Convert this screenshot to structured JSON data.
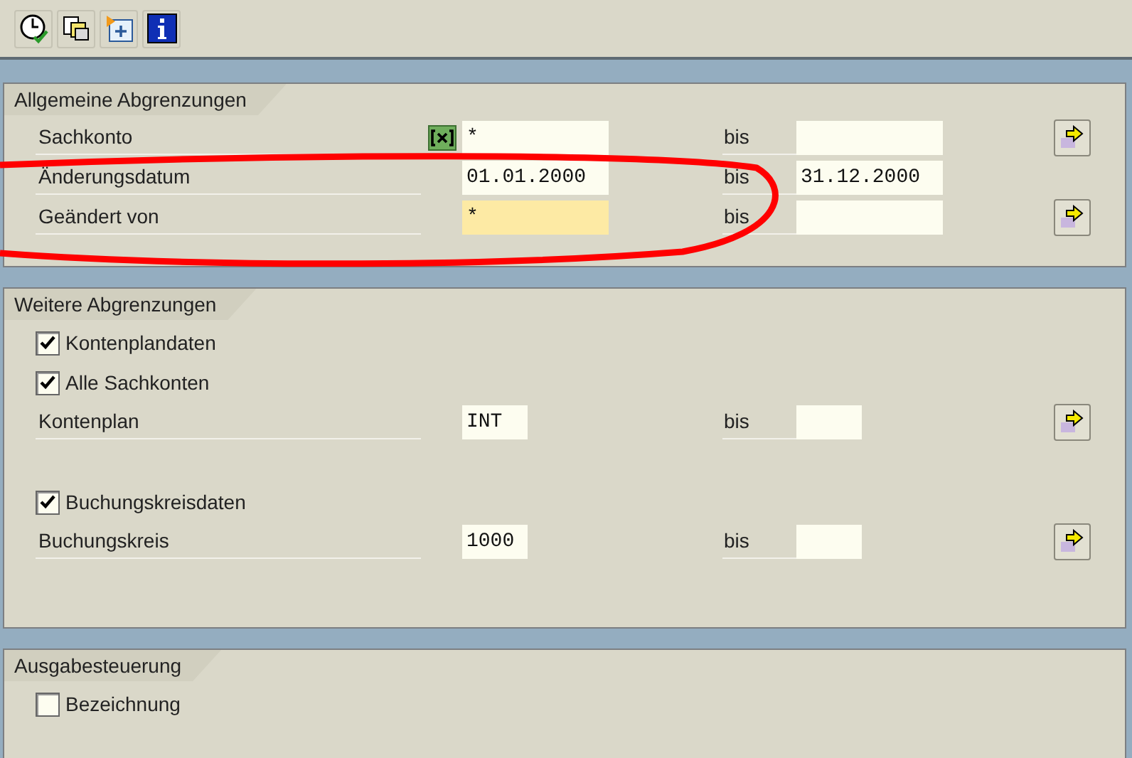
{
  "panels": [
    {
      "title": "Allgemeine Abgrenzungen",
      "groups": [
        [
          {
            "kind": "range",
            "label": "Sachkonto",
            "multi_select": true,
            "from": {
              "value": "*",
              "highlighted": false
            },
            "to_label": "bis",
            "more_button": true
          },
          {
            "kind": "range",
            "label": "Änderungsdatum",
            "multi_select": false,
            "from": {
              "value": "01.01.2000",
              "highlighted": false
            },
            "to_label": "bis",
            "to": {
              "value": "31.12.2000"
            },
            "more_button": false
          },
          {
            "kind": "range",
            "label": "Geändert von",
            "multi_select": false,
            "from": {
              "value": "*",
              "highlighted": true
            },
            "to_label": "bis",
            "more_button": true
          }
        ]
      ]
    },
    {
      "title": "Weitere Abgrenzungen",
      "groups": [
        [
          {
            "kind": "checkbox",
            "label": "Kontenplandaten",
            "checked": true
          },
          {
            "kind": "checkbox",
            "label": "Alle Sachkonten",
            "checked": true
          },
          {
            "kind": "range",
            "label": "Kontenplan",
            "multi_select": false,
            "from": {
              "value": "INT",
              "highlighted": false
            },
            "to_label": "bis",
            "more_button": true
          }
        ],
        [
          {
            "kind": "checkbox",
            "label": "Buchungskreisdaten",
            "checked": true
          },
          {
            "kind": "range",
            "label": "Buchungskreis",
            "multi_select": false,
            "from": {
              "value": "1000",
              "highlighted": false
            },
            "to_label": "bis",
            "more_button": true
          }
        ]
      ]
    },
    {
      "title": "Ausgabesteuerung",
      "groups": [
        [
          {
            "kind": "checkbox",
            "label": "Bezeichnung",
            "checked": false
          }
        ]
      ]
    }
  ]
}
